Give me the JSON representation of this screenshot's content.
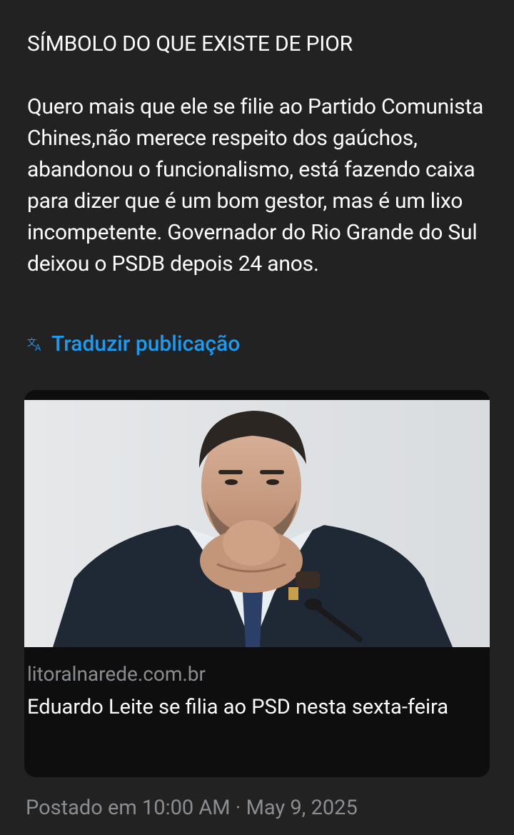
{
  "post": {
    "headline": "SÍMBOLO DO QUE EXISTE DE PIOR",
    "body": "Quero mais que ele se filie ao Partido Comunista Chines,não merece respeito dos gaúchos, abandonou o funcionalismo, está fazendo caixa para dizer que é um bom gestor, mas é um lixo incompetente. Governador do Rio Grande do Sul deixou o PSDB depois 24 anos.",
    "translate_label": "Traduzir publicação",
    "timestamp": "Postado em 10:00 AM · May 9, 2025"
  },
  "link_card": {
    "domain": "litoralnarede.com.br",
    "title": "Eduardo Leite se filia ao PSD nesta sexta-feira"
  },
  "colors": {
    "background": "#222222",
    "link": "#1d9bf0",
    "muted_text": "#8a8d91",
    "card_background": "#0e0e0e"
  },
  "icons": {
    "translate": "translate-icon"
  }
}
